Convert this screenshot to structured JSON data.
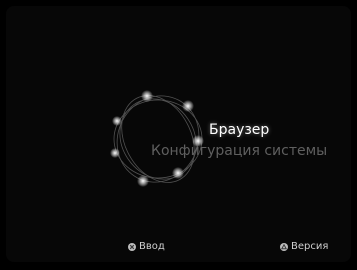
{
  "menu": {
    "items": [
      {
        "label": "Браузер",
        "selected": true
      },
      {
        "label": "Конфигурация системы",
        "selected": false
      }
    ]
  },
  "footer": {
    "enter": {
      "label": "Ввод",
      "icon": "cross-button-icon"
    },
    "version": {
      "label": "Версия",
      "icon": "triangle-button-icon"
    }
  },
  "colors": {
    "background": "#000000",
    "selected_text": "#ffffff",
    "unselected_text": "#5f5f5f",
    "footer_text": "#cfcfcf"
  }
}
